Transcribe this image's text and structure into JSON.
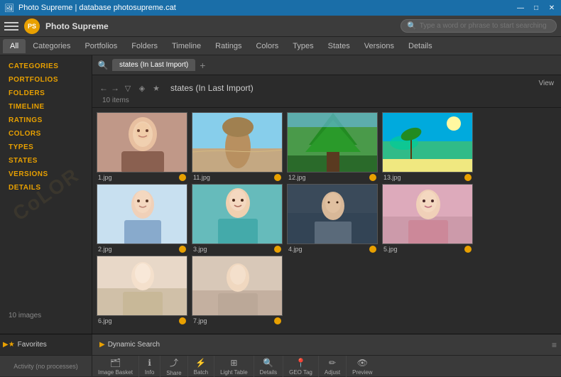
{
  "app": {
    "title": "Photo Supreme | database photosupreme.cat",
    "name": "Photo Supreme",
    "logo_text": "PS"
  },
  "titlebar": {
    "title": "Photo Supreme | database photosupreme.cat",
    "minimize_label": "—",
    "maximize_label": "□",
    "close_label": "✕"
  },
  "toolbar": {
    "search_placeholder": "Type a word or phrase to start searching"
  },
  "nav_tabs": [
    {
      "label": "All",
      "active": true
    },
    {
      "label": "Categories"
    },
    {
      "label": "Portfolios"
    },
    {
      "label": "Folders"
    },
    {
      "label": "Timeline"
    },
    {
      "label": "Ratings"
    },
    {
      "label": "Colors",
      "active_label": true
    },
    {
      "label": "Types"
    },
    {
      "label": "States"
    },
    {
      "label": "Versions"
    },
    {
      "label": "Details"
    }
  ],
  "sidebar": {
    "items": [
      {
        "label": "CATEGORIES"
      },
      {
        "label": "PORTFOLIOS"
      },
      {
        "label": "FOLDERS"
      },
      {
        "label": "TIMELINE"
      },
      {
        "label": "RATINGS"
      },
      {
        "label": "COLORS"
      },
      {
        "label": "TYPES"
      },
      {
        "label": "STATES"
      },
      {
        "label": "VERSIONS"
      },
      {
        "label": "DETAILS"
      }
    ],
    "count_label": "10 images",
    "watermark": "CoLOR"
  },
  "content": {
    "tab_label": "states (In Last Import)",
    "header_title": "states (In Last Import)",
    "header_count": "10 items",
    "view_label": "View",
    "images": [
      {
        "filename": "1.jpg",
        "color": "warm-portrait",
        "row": 0
      },
      {
        "filename": "11.jpg",
        "color": "sky-rock",
        "row": 0
      },
      {
        "filename": "12.jpg",
        "color": "forest-green",
        "row": 0
      },
      {
        "filename": "13.jpg",
        "color": "tropical-beach",
        "row": 0
      },
      {
        "filename": "2.jpg",
        "color": "fashion-blue",
        "row": 1
      },
      {
        "filename": "3.jpg",
        "color": "fashion-teal",
        "row": 1
      },
      {
        "filename": "4.jpg",
        "color": "fashion-dark",
        "row": 1
      },
      {
        "filename": "5.jpg",
        "color": "fashion-pink",
        "row": 1
      },
      {
        "filename": "6.jpg",
        "color": "fashion-white",
        "row": 2
      },
      {
        "filename": "7.jpg",
        "color": "fashion-tan",
        "row": 2
      }
    ]
  },
  "bottom_toolbar": {
    "items": [
      {
        "icon": "🗂",
        "label": "Image Basket"
      },
      {
        "icon": "ℹ",
        "label": "Info"
      },
      {
        "icon": "⤴",
        "label": "Share"
      },
      {
        "icon": "⚡",
        "label": "Batch"
      },
      {
        "icon": "⊞",
        "label": "Light Table"
      },
      {
        "icon": "🔍",
        "label": "Details"
      },
      {
        "icon": "📍",
        "label": "GEO Tag"
      },
      {
        "icon": "✏",
        "label": "Adjust"
      },
      {
        "icon": "👁",
        "label": "Preview"
      }
    ]
  },
  "sidebar_bottom": {
    "favorites_label": "Favorites",
    "dynamic_search_label": "Dynamic Search",
    "activity_label": "Activity (no processes)"
  },
  "colors": {
    "accent_orange": "#e8a000",
    "bg_dark": "#2b2b2b",
    "bg_toolbar": "#3c3c3c",
    "titlebar_blue": "#1a6ea8"
  },
  "image_colors": {
    "warm_portrait": [
      "#c8a090",
      "#8a5040",
      "#e0c0a8"
    ],
    "sky_rock": [
      "#87ceeb",
      "#a08060",
      "#d4b896"
    ],
    "forest_green": [
      "#228B22",
      "#4a7a4a",
      "#90c090"
    ],
    "tropical_beach": [
      "#00aacc",
      "#88cc88",
      "#f4e4a0"
    ],
    "fashion_blue": [
      "#aaccdd",
      "#7799aa",
      "#ddeeff"
    ],
    "fashion_teal": [
      "#55aaaa",
      "#44cc99",
      "#99ddcc"
    ],
    "fashion_dark": [
      "#334455",
      "#556677",
      "#8899aa"
    ],
    "fashion_pink": [
      "#cc8899",
      "#dd99aa",
      "#ffbbcc"
    ],
    "fashion_white": [
      "#ddccbb",
      "#eeddcc",
      "#ffe8d8"
    ],
    "fashion_tan": [
      "#bb9988",
      "#ccaaaa",
      "#ddbbaa"
    ]
  }
}
